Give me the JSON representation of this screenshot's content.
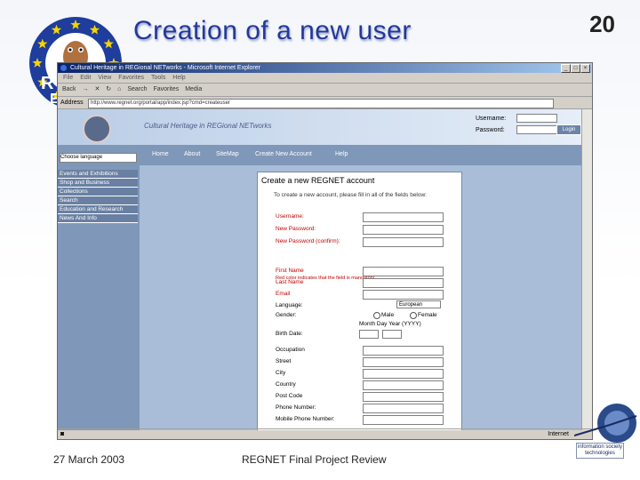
{
  "slide": {
    "title": "Creation of a new user",
    "number": "20",
    "footer_date": "27 March 2003",
    "footer_title": "REGNET Final Project Review",
    "ist_logo_text": "information society technologies",
    "colors": {
      "title": "#24389a",
      "eu_blue": "#1e3d9c",
      "eu_star": "#f5d400"
    }
  },
  "browser": {
    "window_title": "Cultural Heritage in REGional NETworks - Microsoft Internet Explorer",
    "menu": [
      "File",
      "Edit",
      "View",
      "Favorites",
      "Tools",
      "Help"
    ],
    "toolbar": [
      "Back",
      "Search",
      "Favorites",
      "Media"
    ],
    "address_label": "Address",
    "address": "http://www.regnet.org/portal/app/index.jsp?cmd=createuser",
    "status_zone": "Internet"
  },
  "page": {
    "site_name": "Cultural Heritage in REGional NETworks",
    "login": {
      "username_label": "Username:",
      "password_label": "Password:",
      "login_button": "Login"
    },
    "nav": [
      "Home",
      "About",
      "SiteMap",
      "Create New Account",
      "Help"
    ],
    "language_select": "Choose language",
    "left_menu": [
      "Events and Exhibitions",
      "Shop and Business",
      "Collections",
      "Search",
      "Education and Research",
      "News And Info"
    ],
    "form": {
      "title": "Create a new REGNET account",
      "intro": "To create a new account, please fill in all of the fields below:",
      "required_note": "Red color indicates that the field is mandatory.",
      "fields_required_1": [
        "Username:",
        "New Password:",
        "New Password (confirm):"
      ],
      "fields_required_2": [
        "First Name",
        "Last Name",
        "Email"
      ],
      "language_label": "Language:",
      "language_value": "European",
      "gender_label": "Gender:",
      "gender_male": "Male",
      "gender_female": "Female",
      "birth_header": "Month Day Year (YYYY)",
      "birth_label": "Birth Date:",
      "fields_optional": [
        "Occupation",
        "Street",
        "City",
        "Country",
        "Post Code",
        "Phone Number:",
        "Mobile Phone Number:"
      ]
    }
  }
}
